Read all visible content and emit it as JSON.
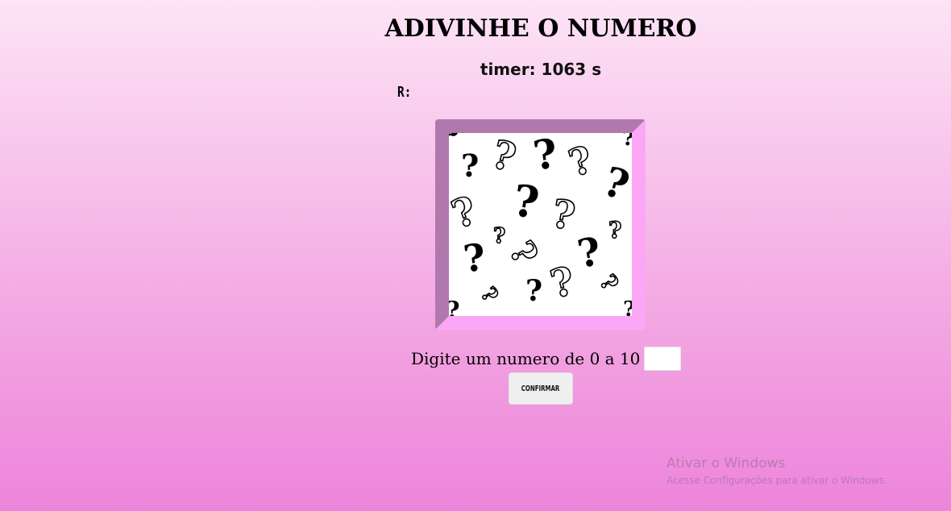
{
  "game": {
    "title": "ADIVINHE O NUMERO",
    "timer_label": "timer:",
    "timer_value": "1063",
    "timer_unit": "s",
    "answer_label": "R:",
    "prompt": "Digite um numero de 0 a 10",
    "input_value": "",
    "input_placeholder": "",
    "confirm_label": "CONFIRMAR",
    "image_icon": "question-marks-pattern-icon"
  },
  "watermark": {
    "title": "Ativar o Windows",
    "subtitle": "Acesse Configurações para ativar o Windows."
  },
  "colors": {
    "background_top": "#fde4f6",
    "background_bottom": "#ee84dc",
    "frame_dark": "#b078ad",
    "frame_light": "#fba7f6"
  }
}
